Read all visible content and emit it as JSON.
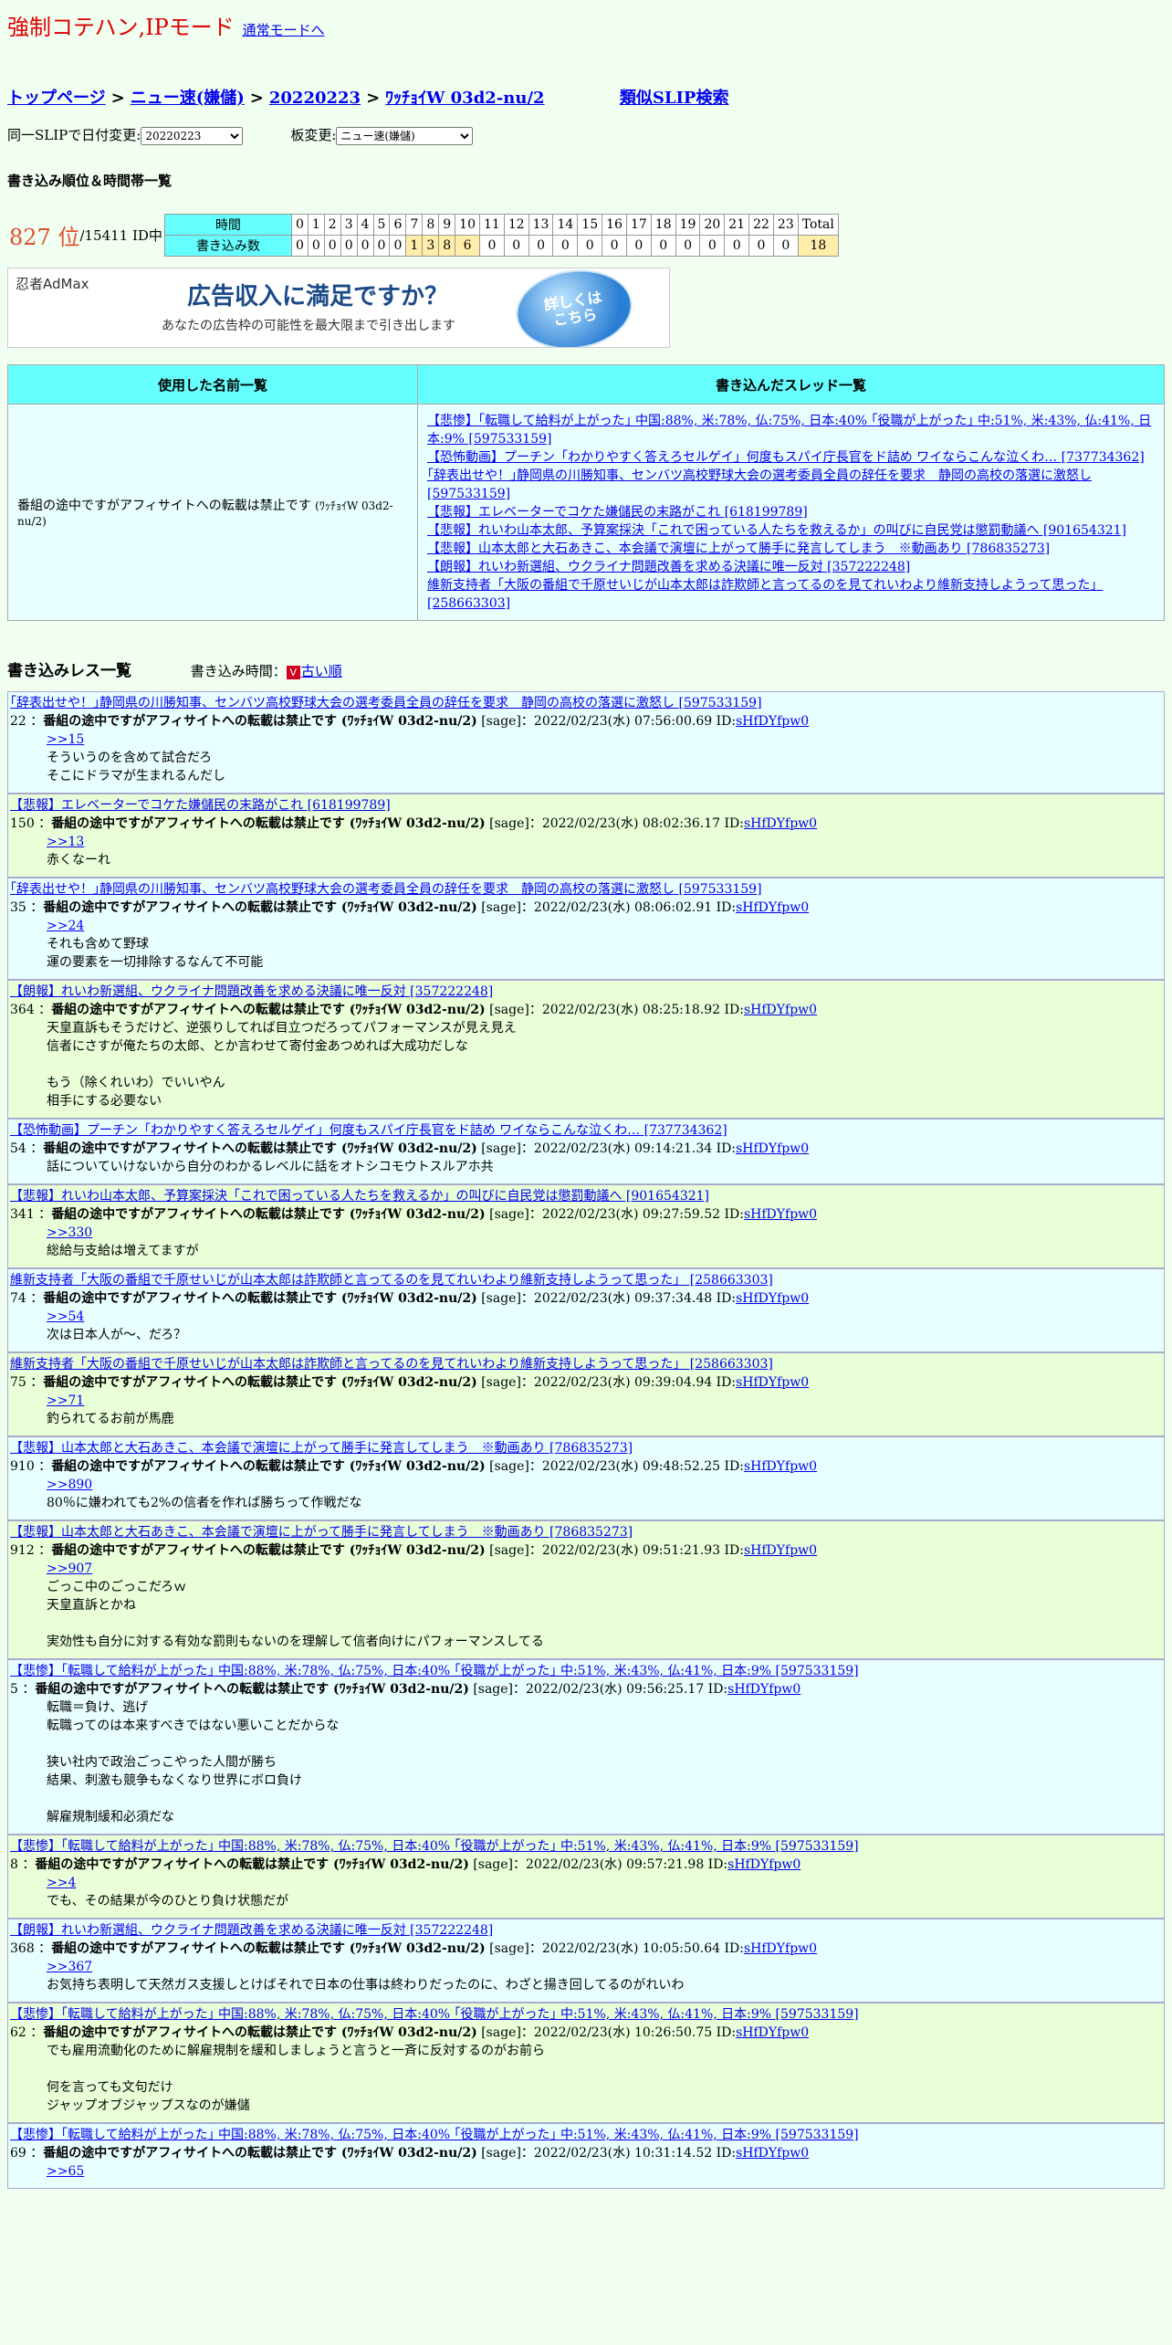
{
  "mode": {
    "title": "強制コテハン,IPモード",
    "normal_link": "通常モードへ"
  },
  "breadcrumb": {
    "top": "トップページ",
    "board": "ニュー速(嫌儲)",
    "date": "20220223",
    "slip": "ﾜｯﾁｮｲW 03d2-nu/2",
    "similar": "類似SLIP検索",
    "sep": ">"
  },
  "selectors": {
    "date_label": "同一SLIPで日付変更:",
    "date_value": "20220223",
    "board_label": "板変更:",
    "board_value": "ニュー速(嫌儲)"
  },
  "rank": {
    "heading": "書き込み順位＆時間帯一覧",
    "position": "827 位",
    "total": "/15411 ID中",
    "time_label": "時間",
    "count_label": "書き込み数",
    "total_label": "Total",
    "hours": [
      "0",
      "1",
      "2",
      "3",
      "4",
      "5",
      "6",
      "7",
      "8",
      "9",
      "10",
      "11",
      "12",
      "13",
      "14",
      "15",
      "16",
      "17",
      "18",
      "19",
      "20",
      "21",
      "22",
      "23"
    ],
    "counts": [
      "0",
      "0",
      "0",
      "0",
      "0",
      "0",
      "0",
      "1",
      "3",
      "8",
      "6",
      "0",
      "0",
      "0",
      "0",
      "0",
      "0",
      "0",
      "0",
      "0",
      "0",
      "0",
      "0",
      "0"
    ],
    "total_value": "18"
  },
  "ad": {
    "logo": "忍者AdMax",
    "headline": "広告収入に満足ですか？",
    "sub": "あなたの広告枠の可能性を最大限まで引き出します",
    "button": "詳しくは\nこちら"
  },
  "names_table": {
    "col_names": "使用した名前一覧",
    "col_threads": "書き込んだスレッド一覧",
    "name": "番組の途中ですがアフィサイトへの転載は禁止です",
    "name_slip": "(ﾜｯﾁｮｲW 03d2-nu/2)",
    "threads": [
      "【悲惨】｢転職して給料が上がった｣ 中国:88%, 米:78%, 仏:75%, 日本:40% ｢役職が上がった｣ 中:51%, 米:43%, 仏:41%, 日本:9% [597533159]",
      "【恐怖動画】プーチン「わかりやすく答えろセルゲイ」何度もスパイ庁長官をド詰め ワイならこんな泣くわ… [737734362]",
      "｢辞表出せや！｣静岡県の川勝知事、センバツ高校野球大会の選考委員全員の辞任を要求　静岡の高校の落選に激怒し [597533159]",
      "【悲報】エレベーターでコケた嫌儲民の末路がこれ [618199789]",
      "【悲報】れいわ山本太郎、予算案採決「これで困っている人たちを救えるか」の叫びに自民党は懲罰動議へ [901654321]",
      "【悲報】山本太郎と大石あきこ、本会議で演壇に上がって勝手に発言してしまう　※動画あり [786835273]",
      "【朗報】れいわ新選組、ウクライナ問題改善を求める決議に唯一反対 [357222248]",
      "維新支持者「大阪の番組で千原せいじが山本太郎は詐欺師と言ってるのを見てれいわより維新支持しようって思った」 [258663303]"
    ]
  },
  "res": {
    "heading": "書き込みレス一覧",
    "order_label": "書き込み時間：",
    "order_icon": "V",
    "order_link": "古い順"
  },
  "posts": [
    {
      "thread": "｢辞表出せや！｣静岡県の川勝知事、センバツ高校野球大会の選考委員全員の辞任を要求　静岡の高校の落選に激怒し [597533159]",
      "num": "22",
      "name": "番組の途中ですがアフィサイトへの転載は禁止です (ﾜｯﾁｮｲW 03d2-nu/2)",
      "meta": "[sage]：2022/02/23(水) 07:56:00.69 ID:",
      "id": "sHfDYfpw0",
      "anchor": ">>15",
      "body": "そういうのを含めて試合だろ\nそこにドラマが生まれるんだし"
    },
    {
      "thread": "【悲報】エレベーターでコケた嫌儲民の末路がこれ [618199789]",
      "num": "150",
      "name": "番組の途中ですがアフィサイトへの転載は禁止です (ﾜｯﾁｮｲW 03d2-nu/2)",
      "meta": "[sage]：2022/02/23(水) 08:02:36.17 ID:",
      "id": "sHfDYfpw0",
      "anchor": ">>13",
      "body": "赤くなーれ"
    },
    {
      "thread": "｢辞表出せや！｣静岡県の川勝知事、センバツ高校野球大会の選考委員全員の辞任を要求　静岡の高校の落選に激怒し [597533159]",
      "num": "35",
      "name": "番組の途中ですがアフィサイトへの転載は禁止です (ﾜｯﾁｮｲW 03d2-nu/2)",
      "meta": "[sage]：2022/02/23(水) 08:06:02.91 ID:",
      "id": "sHfDYfpw0",
      "anchor": ">>24",
      "body": "それも含めて野球\n運の要素を一切排除するなんて不可能"
    },
    {
      "thread": "【朗報】れいわ新選組、ウクライナ問題改善を求める決議に唯一反対 [357222248]",
      "num": "364",
      "name": "番組の途中ですがアフィサイトへの転載は禁止です (ﾜｯﾁｮｲW 03d2-nu/2)",
      "meta": "[sage]：2022/02/23(水) 08:25:18.92 ID:",
      "id": "sHfDYfpw0",
      "anchor": "",
      "body": "天皇直訴もそうだけど、逆張りしてれば目立つだろってパフォーマンスが見え見え\n信者にさすが俺たちの太郎、とか言わせて寄付金あつめれば大成功だしな\n\nもう（除くれいわ）でいいやん\n相手にする必要ない"
    },
    {
      "thread": "【恐怖動画】プーチン「わかりやすく答えろセルゲイ」何度もスパイ庁長官をド詰め ワイならこんな泣くわ… [737734362]",
      "num": "54",
      "name": "番組の途中ですがアフィサイトへの転載は禁止です (ﾜｯﾁｮｲW 03d2-nu/2)",
      "meta": "[sage]：2022/02/23(水) 09:14:21.34 ID:",
      "id": "sHfDYfpw0",
      "anchor": "",
      "body": "話についていけないから自分のわかるレベルに話をオトシコモウトスルアホ共"
    },
    {
      "thread": "【悲報】れいわ山本太郎、予算案採決「これで困っている人たちを救えるか」の叫びに自民党は懲罰動議へ [901654321]",
      "num": "341",
      "name": "番組の途中ですがアフィサイトへの転載は禁止です (ﾜｯﾁｮｲW 03d2-nu/2)",
      "meta": "[sage]：2022/02/23(水) 09:27:59.52 ID:",
      "id": "sHfDYfpw0",
      "anchor": ">>330",
      "body": "総給与支給は増えてますが"
    },
    {
      "thread": "維新支持者「大阪の番組で千原せいじが山本太郎は詐欺師と言ってるのを見てれいわより維新支持しようって思った」 [258663303]",
      "num": "74",
      "name": "番組の途中ですがアフィサイトへの転載は禁止です (ﾜｯﾁｮｲW 03d2-nu/2)",
      "meta": "[sage]：2022/02/23(水) 09:37:34.48 ID:",
      "id": "sHfDYfpw0",
      "anchor": ">>54",
      "body": "次は日本人が～、だろ？"
    },
    {
      "thread": "維新支持者「大阪の番組で千原せいじが山本太郎は詐欺師と言ってるのを見てれいわより維新支持しようって思った」 [258663303]",
      "num": "75",
      "name": "番組の途中ですがアフィサイトへの転載は禁止です (ﾜｯﾁｮｲW 03d2-nu/2)",
      "meta": "[sage]：2022/02/23(水) 09:39:04.94 ID:",
      "id": "sHfDYfpw0",
      "anchor": ">>71",
      "body": "釣られてるお前が馬鹿"
    },
    {
      "thread": "【悲報】山本太郎と大石あきこ、本会議で演壇に上がって勝手に発言してしまう　※動画あり [786835273]",
      "num": "910",
      "name": "番組の途中ですがアフィサイトへの転載は禁止です (ﾜｯﾁｮｲW 03d2-nu/2)",
      "meta": "[sage]：2022/02/23(水) 09:48:52.25 ID:",
      "id": "sHfDYfpw0",
      "anchor": ">>890",
      "body": "80％に嫌われても2%の信者を作れば勝ちって作戦だな"
    },
    {
      "thread": "【悲報】山本太郎と大石あきこ、本会議で演壇に上がって勝手に発言してしまう　※動画あり [786835273]",
      "num": "912",
      "name": "番組の途中ですがアフィサイトへの転載は禁止です (ﾜｯﾁｮｲW 03d2-nu/2)",
      "meta": "[sage]：2022/02/23(水) 09:51:21.93 ID:",
      "id": "sHfDYfpw0",
      "anchor": ">>907",
      "body": "ごっこ中のごっこだろｗ\n天皇直訴とかね\n\n実効性も自分に対する有効な罰則もないのを理解して信者向けにパフォーマンスしてる"
    },
    {
      "thread": "【悲惨】｢転職して給料が上がった｣ 中国:88%, 米:78%, 仏:75%, 日本:40% ｢役職が上がった｣ 中:51%, 米:43%, 仏:41%, 日本:9% [597533159]",
      "num": "5",
      "name": "番組の途中ですがアフィサイトへの転載は禁止です (ﾜｯﾁｮｲW 03d2-nu/2)",
      "meta": "[sage]：2022/02/23(水) 09:56:25.17 ID:",
      "id": "sHfDYfpw0",
      "anchor": "",
      "body": "転職＝負け、逃げ\n転職ってのは本来すべきではない悪いことだからな\n\n狭い社内で政治ごっこやった人間が勝ち\n結果、刺激も競争もなくなり世界にボロ負け\n\n解雇規制緩和必須だな"
    },
    {
      "thread": "【悲惨】｢転職して給料が上がった｣ 中国:88%, 米:78%, 仏:75%, 日本:40% ｢役職が上がった｣ 中:51%, 米:43%, 仏:41%, 日本:9% [597533159]",
      "num": "8",
      "name": "番組の途中ですがアフィサイトへの転載は禁止です (ﾜｯﾁｮｲW 03d2-nu/2)",
      "meta": "[sage]：2022/02/23(水) 09:57:21.98 ID:",
      "id": "sHfDYfpw0",
      "anchor": ">>4",
      "body": "でも、その結果が今のひとり負け状態だが"
    },
    {
      "thread": "【朗報】れいわ新選組、ウクライナ問題改善を求める決議に唯一反対 [357222248]",
      "num": "368",
      "name": "番組の途中ですがアフィサイトへの転載は禁止です (ﾜｯﾁｮｲW 03d2-nu/2)",
      "meta": "[sage]：2022/02/23(水) 10:05:50.64 ID:",
      "id": "sHfDYfpw0",
      "anchor": ">>367",
      "body": "お気持ち表明して天然ガス支援しとけばそれで日本の仕事は終わりだったのに、わざと揚き回してるのがれいわ"
    },
    {
      "thread": "【悲惨】｢転職して給料が上がった｣ 中国:88%, 米:78%, 仏:75%, 日本:40% ｢役職が上がった｣ 中:51%, 米:43%, 仏:41%, 日本:9% [597533159]",
      "num": "62",
      "name": "番組の途中ですがアフィサイトへの転載は禁止です (ﾜｯﾁｮｲW 03d2-nu/2)",
      "meta": "[sage]：2022/02/23(水) 10:26:50.75 ID:",
      "id": "sHfDYfpw0",
      "anchor": "",
      "body": "でも雇用流動化のために解雇規制を緩和しましょうと言うと一斉に反対するのがお前ら\n\n何を言っても文句だけ\nジャップオブジャップスなのが嫌儲"
    },
    {
      "thread": "【悲惨】｢転職して給料が上がった｣ 中国:88%, 米:78%, 仏:75%, 日本:40% ｢役職が上がった｣ 中:51%, 米:43%, 仏:41%, 日本:9% [597533159]",
      "num": "69",
      "name": "番組の途中ですがアフィサイトへの転載は禁止です (ﾜｯﾁｮｲW 03d2-nu/2)",
      "meta": "[sage]：2022/02/23(水) 10:31:14.52 ID:",
      "id": "sHfDYfpw0",
      "anchor": ">>65",
      "body": ""
    }
  ]
}
